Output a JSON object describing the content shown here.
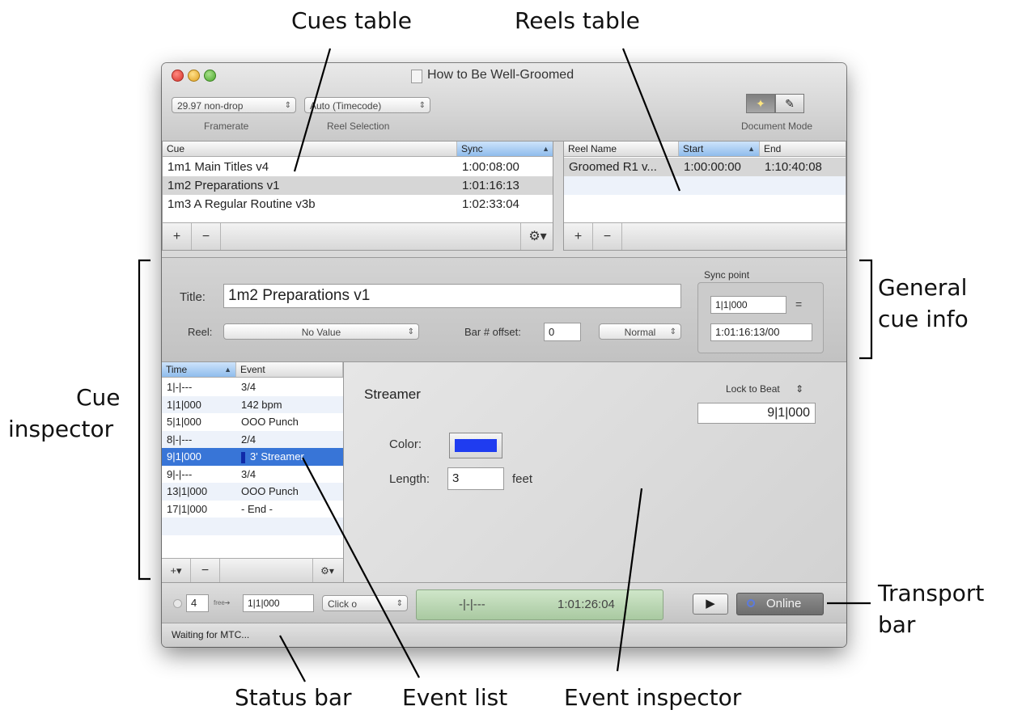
{
  "annotations": {
    "cues_table": "Cues table",
    "reels_table": "Reels table",
    "general_cue_info": [
      "General",
      "cue info"
    ],
    "cue_inspector": [
      "Cue",
      "inspector"
    ],
    "transport_bar": [
      "Transport",
      "bar"
    ],
    "status_bar": "Status bar",
    "event_list": "Event list",
    "event_inspector": "Event inspector"
  },
  "window": {
    "title": "How to Be Well-Groomed"
  },
  "toolbar": {
    "framerate": {
      "value": "29.97 non-drop",
      "caption": "Framerate"
    },
    "reel_selection": {
      "value": "Auto (Timecode)",
      "caption": "Reel Selection"
    },
    "document_mode": {
      "caption": "Document Mode",
      "icons": [
        "wand-icon",
        "pencil-icon"
      ]
    }
  },
  "cues_table": {
    "columns": [
      "Cue",
      "Sync"
    ],
    "rows": [
      {
        "cue": "1m1 Main Titles v4",
        "sync": "1:00:08:00"
      },
      {
        "cue": "1m2 Preparations v1",
        "sync": "1:01:16:13"
      },
      {
        "cue": "1m3 A Regular Routine v3b",
        "sync": "1:02:33:04"
      }
    ],
    "selected_index": 1,
    "footer": {
      "add": "+",
      "remove": "−",
      "action": "⚙▾"
    }
  },
  "reels_table": {
    "columns": [
      "Reel Name",
      "Start",
      "End"
    ],
    "rows": [
      {
        "name": "Groomed R1 v...",
        "start": "1:00:00:00",
        "end": "1:10:40:08"
      }
    ],
    "footer": {
      "add": "+",
      "remove": "−"
    }
  },
  "cue_info": {
    "title_label": "Title:",
    "title_value": "1m2 Preparations v1",
    "reel_label": "Reel:",
    "reel_value": "No Value",
    "bar_offset_label": "Bar # offset:",
    "bar_offset_value": "0",
    "mode_value": "Normal",
    "sync_point": {
      "label": "Sync point",
      "bar_value": "1|1|000",
      "equals": "=",
      "timecode_value": "1:01:16:13/00"
    }
  },
  "event_list": {
    "columns": [
      "Time",
      "Event"
    ],
    "rows": [
      {
        "time": "1|-|---",
        "event": "3/4"
      },
      {
        "time": "1|1|000",
        "event": "142 bpm"
      },
      {
        "time": "5|1|000",
        "event": "OOO Punch"
      },
      {
        "time": "8|-|---",
        "event": "2/4"
      },
      {
        "time": "9|1|000",
        "event": "3' Streamer"
      },
      {
        "time": "9|-|---",
        "event": "3/4"
      },
      {
        "time": "13|1|000",
        "event": "OOO Punch"
      },
      {
        "time": "17|1|000",
        "event": "- End -"
      }
    ],
    "selected_index": 4,
    "footer": {
      "add": "+▾",
      "remove": "−",
      "action": "⚙▾"
    }
  },
  "event_inspector": {
    "heading": "Streamer",
    "lock_label": "Lock to Beat",
    "lock_value": "9|1|000",
    "color_label": "Color:",
    "color_value": "#1f3cf0",
    "length_label": "Length:",
    "length_value": "3",
    "length_unit": "feet"
  },
  "transport": {
    "count_in": "4",
    "count_label": "free",
    "position": "1|1|000",
    "click_value": "Click o",
    "lcd_bars": "-|-|---",
    "lcd_timecode": "1:01:26:04",
    "play": "▶",
    "online_label": "Online"
  },
  "status_bar": {
    "text": "Waiting for MTC..."
  }
}
